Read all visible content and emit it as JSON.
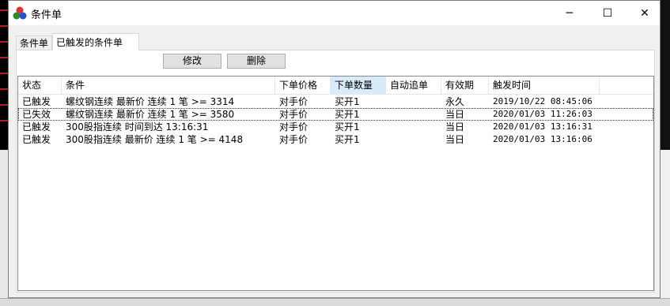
{
  "window": {
    "title": "条件单",
    "controls": {
      "minimize": "─",
      "maximize": "☐",
      "close": "✕"
    }
  },
  "tabs": [
    {
      "label": "条件单",
      "active": false
    },
    {
      "label": "已触发的条件单",
      "active": true
    }
  ],
  "toolbar": {
    "edit_label": "修改",
    "delete_label": "删除"
  },
  "table": {
    "columns": [
      "状态",
      "条件",
      "下单价格",
      "下单数量",
      "自动追单",
      "有效期",
      "触发时间"
    ],
    "sorted_column": "下单数量",
    "rows": [
      {
        "status": "已触发",
        "condition": "螺纹钢连续 最新价 连续 1 笔 >= 3314",
        "price": "对手价",
        "qty": "买开1",
        "auto": "",
        "validity": "永久",
        "time": "2019/10/22 08:45:06"
      },
      {
        "status": "已失效",
        "condition": "螺纹钢连续 最新价 连续 1 笔 >= 3580",
        "price": "对手价",
        "qty": "买开1",
        "auto": "",
        "validity": "当日",
        "time": "2020/01/03 11:26:03"
      },
      {
        "status": "已触发",
        "condition": "300股指连续 时间到达 13:16:31",
        "price": "对手价",
        "qty": "买开1",
        "auto": "",
        "validity": "当日",
        "time": "2020/01/03 13:16:31"
      },
      {
        "status": "已触发",
        "condition": "300股指连续 最新价 连续 1 笔 >= 4148",
        "price": "对手价",
        "qty": "买开1",
        "auto": "",
        "validity": "当日",
        "time": "2020/01/03 13:16:06"
      }
    ]
  },
  "colors": {
    "sorted_header": "#d9ebf9",
    "background_app_accent": "#b02020"
  }
}
